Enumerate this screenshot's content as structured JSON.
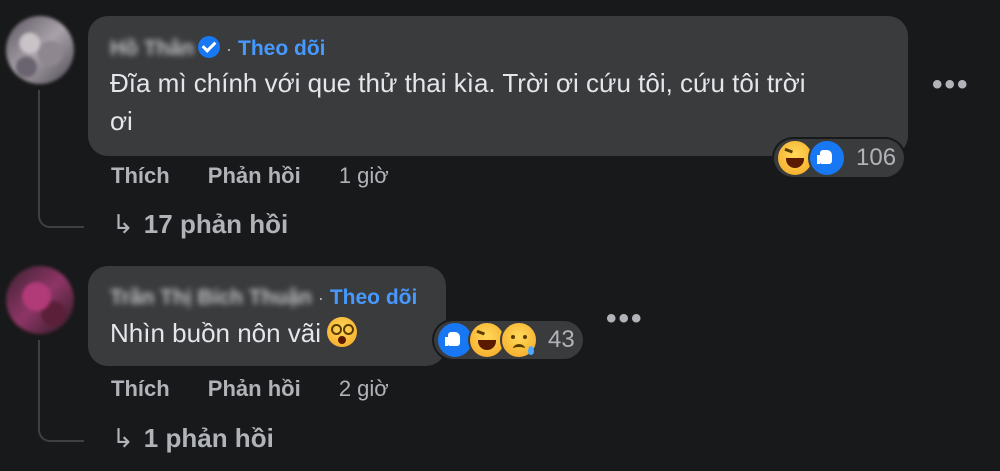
{
  "comments": [
    {
      "author": "Hồ Thân",
      "verified": true,
      "separator": "·",
      "follow_label": "Theo dõi",
      "text": "Đĩa mì chính với que thử thai kìa. Trời ơi cứu tôi, cứu tôi trời ơi",
      "text_line1": "Đĩa mì chính với que thử thai kìa. Trời ơi cứu tôi, cứu tôi trời",
      "text_line2": "ơi",
      "reactions": [
        "haha",
        "like"
      ],
      "reaction_count": "106",
      "like_label": "Thích",
      "reply_label": "Phản hồi",
      "time": "1 giờ",
      "replies_label": "17 phản hồi",
      "more_icon": "more-horizontal-icon"
    },
    {
      "author": "Trần Thị Bích Thuận",
      "verified": false,
      "separator": "·",
      "follow_label": "Theo dõi",
      "text": "Nhìn buồn nôn vãi",
      "inline_emoji": "dizzy-face-emoji",
      "reactions": [
        "like",
        "haha",
        "sad"
      ],
      "reaction_count": "43",
      "like_label": "Thích",
      "reply_label": "Phản hồi",
      "time": "2 giờ",
      "replies_label": "1 phản hồi",
      "more_icon": "more-horizontal-icon"
    }
  ],
  "colors": {
    "background": "#18191a",
    "bubble": "#3a3b3c",
    "accent": "#4599ff",
    "secondary_text": "#b0b3b8"
  },
  "reply_arrow": "↳",
  "more_glyph": "•••"
}
